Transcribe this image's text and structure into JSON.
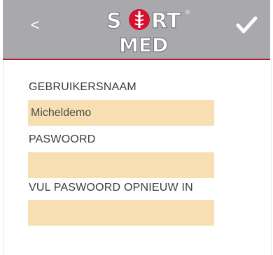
{
  "header": {
    "back_label": "<",
    "confirm_label": "✔",
    "logo": {
      "top_text": "SPORT",
      "bottom_text": "MED",
      "mark": "®"
    }
  },
  "form": {
    "username_label": "GEBRUIKERSNAAM",
    "username_value": "Micheldemo",
    "password_label": "PASWOORD",
    "password_value": "",
    "repeat_password_label": "VUL PASWOORD OPNIEUW IN",
    "repeat_password_value": ""
  },
  "colors": {
    "header_bg": "#a9a9ad",
    "header_border": "#b01a34",
    "field_bg": "#f8dfb3",
    "logo_red": "#d4122f"
  }
}
